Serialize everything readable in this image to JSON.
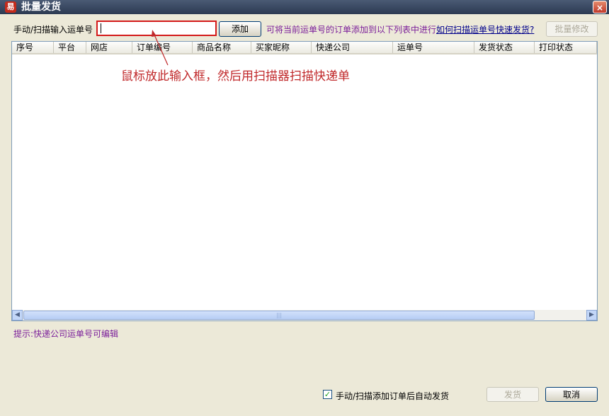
{
  "window": {
    "title": "批量发货",
    "app_icon_glyph": "易",
    "close_glyph": "×"
  },
  "toolbar": {
    "scan_label": "手动/扫描输入运单号",
    "scan_value": "",
    "add_button": "添加",
    "hint_text": "可将当前运单号的订单添加到以下列表中进行",
    "help_link": "如何扫描运单号快速发货?",
    "batch_edit_button": "批量修改"
  },
  "table": {
    "columns": [
      "序号",
      "平台",
      "网店",
      "订单编号",
      "商品名称",
      "买家昵称",
      "快递公司",
      "运单号",
      "发货状态",
      "打印状态"
    ],
    "rows": []
  },
  "annotation": "鼠标放此输入框，然后用扫描器扫描快递单",
  "tip": "提示:快递公司运单号可编辑",
  "footer": {
    "auto_ship_label": "手动/扫描添加订单后自动发货",
    "auto_ship_checked": true,
    "ship_button": "发货",
    "cancel_button": "取消"
  },
  "colors": {
    "accent_red": "#c0282a",
    "hint_purple": "#7b1f9a",
    "link_blue": "#00008b",
    "title_bar": "#3a4a64"
  }
}
